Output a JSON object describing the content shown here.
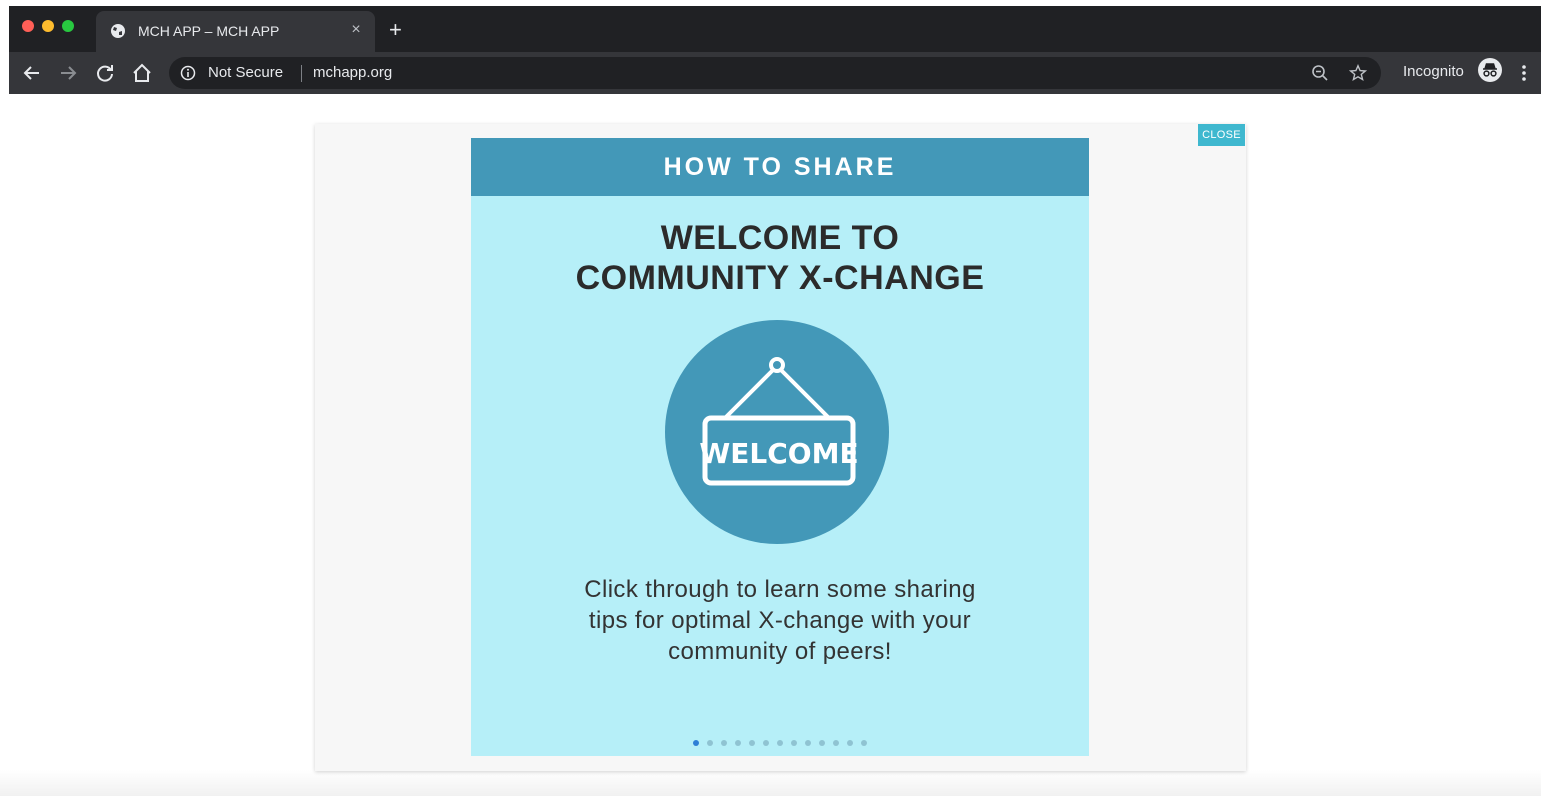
{
  "browser": {
    "tab_title": "MCH APP – MCH APP",
    "new_tab_symbol": "+",
    "tab_close_symbol": "×",
    "security_label": "Not Secure",
    "url": "mchapp.org",
    "incognito_label": "Incognito",
    "icons": [
      "back-icon",
      "forward-icon",
      "reload-icon",
      "home-icon",
      "info-icon",
      "zoom-icon",
      "star-icon",
      "incognito-icon",
      "menu-icon"
    ]
  },
  "modal": {
    "close_label": "CLOSE",
    "slide": {
      "header": "HOW TO SHARE",
      "title_lines": [
        "WELCOME TO",
        "COMMUNITY X-CHANGE"
      ],
      "sign_text": "WELCOME",
      "body_lines": [
        "Click through to learn some sharing",
        "tips for optimal X-change with your",
        "community of peers!"
      ],
      "pagination": {
        "total": 13,
        "current": 1
      }
    }
  },
  "colors": {
    "header_blue": "#4398b8",
    "slide_bg": "#b6eff8",
    "close_bg": "#3fb8cf",
    "active_dot": "#2e7fd6"
  }
}
